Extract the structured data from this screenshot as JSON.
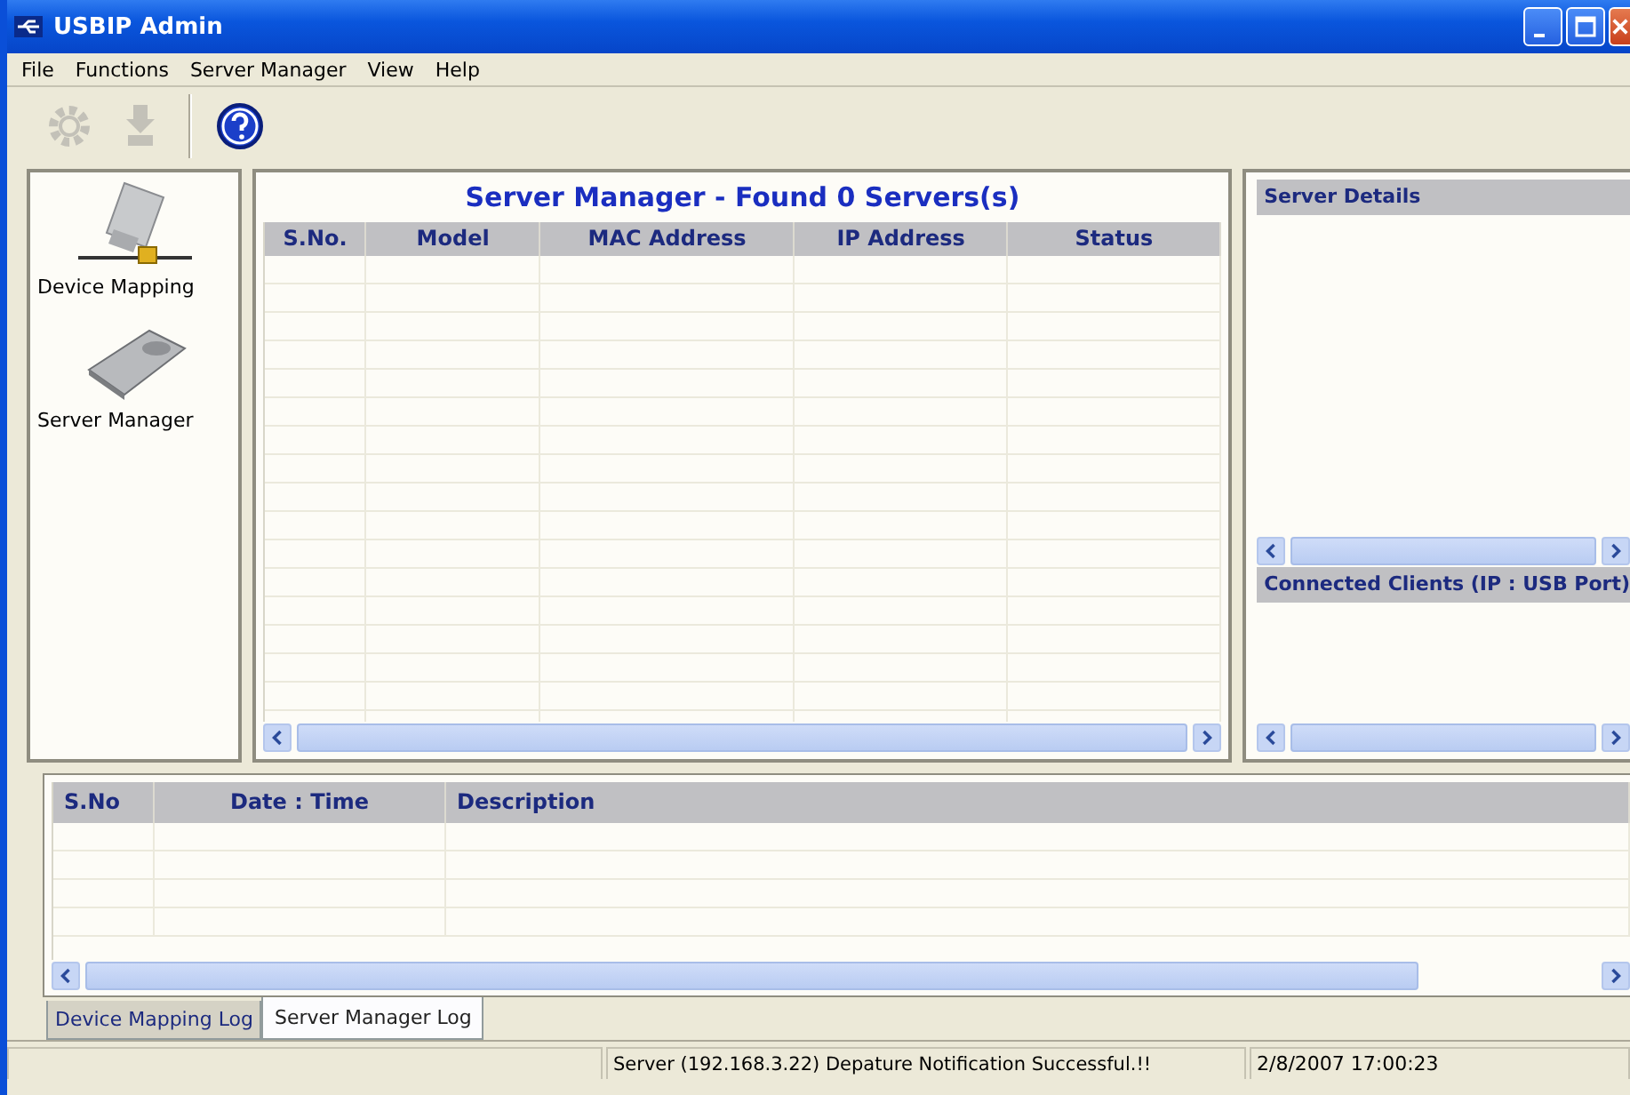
{
  "window": {
    "title": "USBIP Admin"
  },
  "menu": [
    "File",
    "Functions",
    "Server Manager",
    "View",
    "Help"
  ],
  "toolbar": [
    {
      "kind": "gear",
      "disabled": true
    },
    {
      "kind": "download",
      "disabled": true
    },
    {
      "kind": "help",
      "disabled": false
    }
  ],
  "sidebar": {
    "items": [
      {
        "kind": "usb",
        "label": "Device Mapping"
      },
      {
        "kind": "server",
        "label": "Server Manager"
      }
    ]
  },
  "server_panel": {
    "title": "Server Manager - Found 0 Servers(s)",
    "columns": [
      "S.No.",
      "Model",
      "MAC Address",
      "IP Address",
      "Status"
    ]
  },
  "details": {
    "server_details_title": "Server Details",
    "clients_title": "Connected Clients (IP : USB Port)"
  },
  "log": {
    "columns": [
      "S.No",
      "Date : Time",
      "Description"
    ]
  },
  "tabs": [
    {
      "label": "Device Mapping Log",
      "selected": false
    },
    {
      "label": "Server Manager Log",
      "selected": true
    }
  ],
  "status_bar": {
    "message": "Server (192.168.3.22) Depature Notification Successful.!!",
    "time": "2/8/2007 17:00:23"
  }
}
